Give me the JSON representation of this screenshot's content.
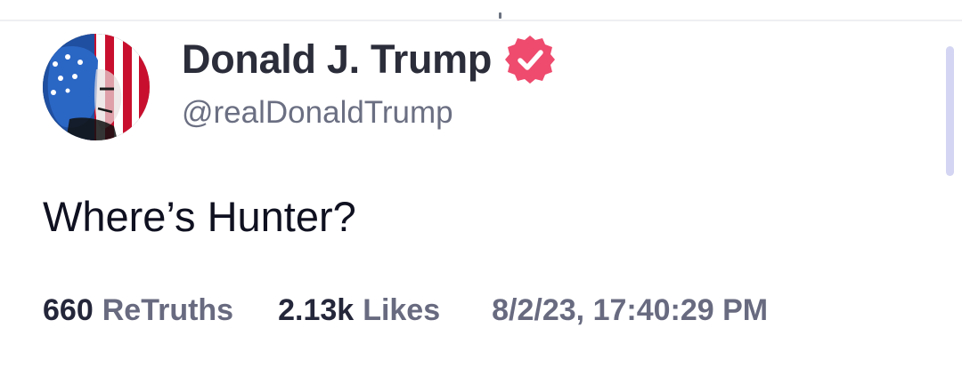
{
  "post": {
    "author": {
      "display_name": "Donald J. Trump",
      "handle": "@realDonaldTrump",
      "verified": true,
      "avatar_icon": "flag-portrait-avatar"
    },
    "text": "Where’s Hunter?",
    "stats": {
      "retruths_count": "660",
      "retruths_label": "ReTruths",
      "likes_count": "2.13k",
      "likes_label": "Likes"
    },
    "timestamp": "8/2/23, 17:40:29 PM"
  },
  "colors": {
    "verified_badge": "#ee4b6e",
    "text_primary": "#2b2d3a",
    "text_secondary": "#686b80",
    "scrollbar": "#d4d5f2"
  }
}
